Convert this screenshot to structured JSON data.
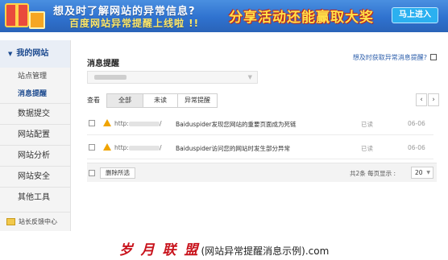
{
  "banner": {
    "line1": "想及时了解网站的异常信息?",
    "line2": "百度网站异常提醒上线啦 !!",
    "slogan": "分享活动还能赢取大奖",
    "cta": "马上进入"
  },
  "sidebar": {
    "section_title": "我的网站",
    "subitems": [
      "站点管理",
      "消息提醒"
    ],
    "items": [
      "数据提交",
      "网站配置",
      "网站分析",
      "网站安全",
      "其他工具"
    ],
    "feedback": "站长反馈中心"
  },
  "main": {
    "title": "消息提醒",
    "help_link": "想及时获取异常消息提醒?",
    "filter_label": "查看",
    "tabs": [
      "全部",
      "未读",
      "异常提醒"
    ],
    "pager": {
      "prev": "‹",
      "next": "›"
    },
    "messages": [
      {
        "url_prefix": "http:",
        "url_suffix": "/ ",
        "text": "Baiduspider发现您网站的重要页面成为死链",
        "status": "已读",
        "date": "06-06"
      },
      {
        "url_prefix": "http:",
        "url_suffix": "/ ",
        "text": "Baiduspider访问您的网站时发生部分异常",
        "status": "已读",
        "date": "06-06"
      }
    ],
    "footer": {
      "delete_label": "删除所选",
      "count_label": "共2条  每页显示 :",
      "per_page": "20"
    }
  },
  "watermark": {
    "brand": "岁 月 联 盟",
    "caption": "(网站异常提醒消息示例).com"
  }
}
